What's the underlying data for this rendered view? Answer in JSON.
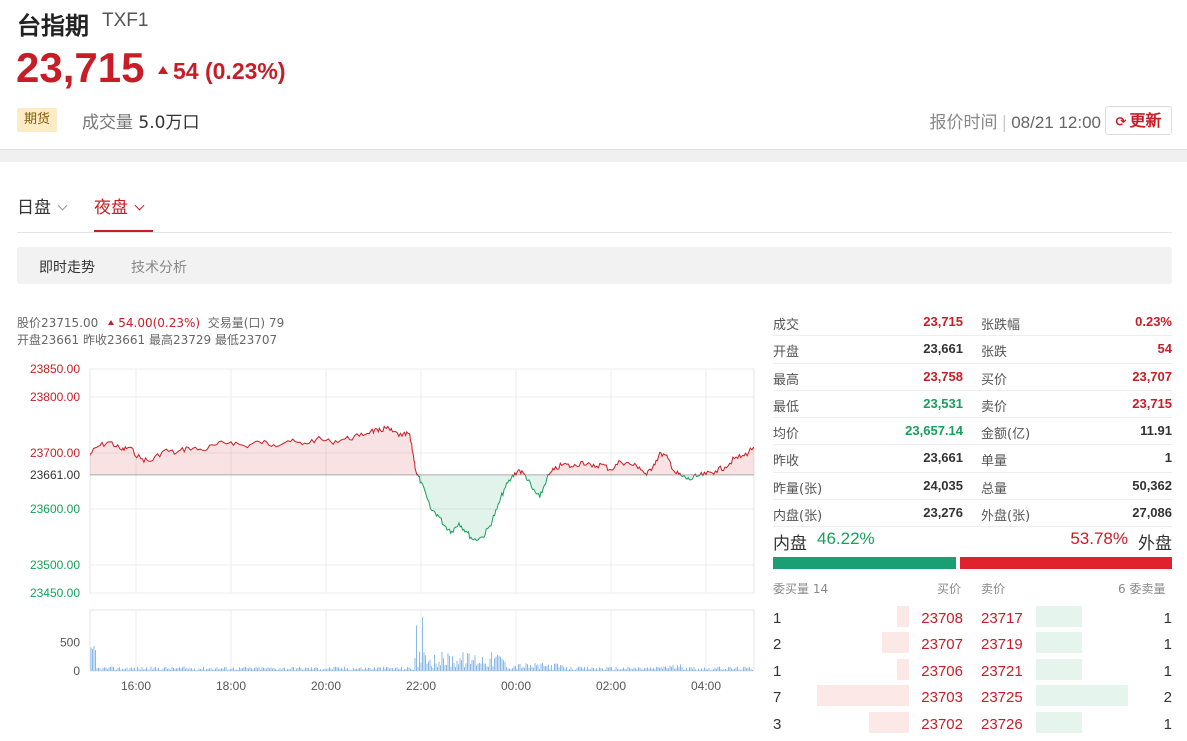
{
  "header": {
    "name": "台指期",
    "code": "TXF1",
    "price": "23,715",
    "change": "54 (0.23%)",
    "badge": "期货",
    "volume_label": "成交量",
    "volume_value": "5.0万口",
    "quote_time_label": "报价时间",
    "quote_time_value": "08/21 12:00",
    "refresh_label": "更新"
  },
  "session_tabs": [
    {
      "label": "日盘",
      "active": false
    },
    {
      "label": "夜盘",
      "active": true
    }
  ],
  "sub_tabs": [
    {
      "label": "即时走势",
      "active": true
    },
    {
      "label": "技术分析",
      "active": false
    }
  ],
  "chart_info": {
    "line1_price": "股价23715.00",
    "line1_change": "54.00(0.23%)",
    "line1_volume": "交易量(口) 79",
    "line2": "开盘23661  昨收23661  最高23729  最低23707"
  },
  "colors": {
    "up": "#c81d26",
    "down": "#16a05a",
    "volume": "#8ab9e8"
  },
  "chart_data": {
    "type": "area",
    "prev_close": 23661,
    "ylim": [
      23450,
      23850
    ],
    "yticks": [
      "23850.00",
      "23800.00",
      "23700.00",
      "23661.00",
      "23600.00",
      "23500.00",
      "23450.00"
    ],
    "ytick_values": [
      23850,
      23800,
      23700,
      23661,
      23600,
      23500,
      23450
    ],
    "xticks": [
      "16:00",
      "18:00",
      "20:00",
      "22:00",
      "00:00",
      "02:00",
      "04:00"
    ],
    "price_series": [
      [
        0,
        23695
      ],
      [
        0.2,
        23712
      ],
      [
        0.45,
        23720
      ],
      [
        0.7,
        23705
      ],
      [
        0.85,
        23710
      ],
      [
        1.1,
        23690
      ],
      [
        1.3,
        23685
      ],
      [
        1.6,
        23705
      ],
      [
        1.85,
        23700
      ],
      [
        2.1,
        23710
      ],
      [
        2.4,
        23705
      ],
      [
        2.7,
        23715
      ],
      [
        3.0,
        23720
      ],
      [
        3.3,
        23712
      ],
      [
        3.6,
        23720
      ],
      [
        3.9,
        23715
      ],
      [
        4.2,
        23722
      ],
      [
        4.5,
        23715
      ],
      [
        4.8,
        23725
      ],
      [
        5.1,
        23720
      ],
      [
        5.4,
        23725
      ],
      [
        5.7,
        23730
      ],
      [
        5.95,
        23740
      ],
      [
        6.1,
        23738
      ],
      [
        6.25,
        23745
      ],
      [
        6.4,
        23738
      ],
      [
        6.6,
        23730
      ],
      [
        6.75,
        23735
      ],
      [
        6.83,
        23700
      ],
      [
        6.9,
        23665
      ],
      [
        7.0,
        23648
      ],
      [
        7.2,
        23600
      ],
      [
        7.35,
        23590
      ],
      [
        7.5,
        23570
      ],
      [
        7.65,
        23560
      ],
      [
        7.8,
        23575
      ],
      [
        7.95,
        23560
      ],
      [
        8.1,
        23545
      ],
      [
        8.3,
        23550
      ],
      [
        8.45,
        23570
      ],
      [
        8.6,
        23600
      ],
      [
        8.75,
        23635
      ],
      [
        8.9,
        23655
      ],
      [
        9.05,
        23670
      ],
      [
        9.2,
        23660
      ],
      [
        9.35,
        23635
      ],
      [
        9.5,
        23620
      ],
      [
        9.65,
        23655
      ],
      [
        9.8,
        23670
      ],
      [
        10.0,
        23680
      ],
      [
        10.2,
        23675
      ],
      [
        10.4,
        23685
      ],
      [
        10.6,
        23675
      ],
      [
        10.8,
        23680
      ],
      [
        11.0,
        23670
      ],
      [
        11.2,
        23685
      ],
      [
        11.4,
        23680
      ],
      [
        11.6,
        23675
      ],
      [
        11.75,
        23660
      ],
      [
        11.9,
        23680
      ],
      [
        12.05,
        23700
      ],
      [
        12.2,
        23690
      ],
      [
        12.35,
        23665
      ],
      [
        12.5,
        23658
      ],
      [
        12.65,
        23652
      ],
      [
        12.8,
        23658
      ],
      [
        13.0,
        23662
      ],
      [
        13.2,
        23668
      ],
      [
        13.4,
        23675
      ],
      [
        13.6,
        23690
      ],
      [
        13.8,
        23695
      ],
      [
        14.0,
        23710
      ],
      [
        14.2,
        23702
      ],
      [
        14.4,
        23720
      ],
      [
        14.6,
        23715
      ],
      [
        14.8,
        23718
      ],
      [
        15.0,
        23714
      ],
      [
        15.2,
        23716
      ],
      [
        15.4,
        23718
      ],
      [
        15.55,
        23715
      ]
    ],
    "volume_ylim": [
      0,
      1000
    ],
    "volume_yticks": [
      "500",
      "0"
    ],
    "volume_ytick_values": [
      500,
      0
    ]
  },
  "stats": [
    {
      "l1": "成交",
      "v1": "23,715",
      "c1": "red",
      "l2": "张跌幅",
      "v2": "0.23%",
      "c2": "red"
    },
    {
      "l1": "开盘",
      "v1": "23,661",
      "c1": "dark",
      "l2": "张跌",
      "v2": "54",
      "c2": "red"
    },
    {
      "l1": "最高",
      "v1": "23,758",
      "c1": "red",
      "l2": "买价",
      "v2": "23,707",
      "c2": "red"
    },
    {
      "l1": "最低",
      "v1": "23,531",
      "c1": "green",
      "l2": "卖价",
      "v2": "23,715",
      "c2": "red"
    },
    {
      "l1": "均价",
      "v1": "23,657.14",
      "c1": "green",
      "l2": "金额(亿)",
      "v2": "11.91",
      "c2": "dark"
    },
    {
      "l1": "昨收",
      "v1": "23,661",
      "c1": "dark",
      "l2": "单量",
      "v2": "1",
      "c2": "dark"
    },
    {
      "l1": "昨量(张)",
      "v1": "24,035",
      "c1": "dark",
      "l2": "总量",
      "v2": "50,362",
      "c2": "dark"
    },
    {
      "l1": "内盘(张)",
      "v1": "23,276",
      "c1": "dark",
      "l2": "外盘(张)",
      "v2": "27,086",
      "c2": "dark"
    }
  ],
  "inout": {
    "in_label": "内盘",
    "in_pct": "46.22%",
    "out_pct": "53.78%",
    "out_label": "外盘",
    "in_fraction": 0.4622
  },
  "orderbook": {
    "bid_qty_label": "委买量 14",
    "bid_price_label": "买价",
    "ask_price_label": "卖价",
    "ask_qty_label": "6 委卖量",
    "rows": [
      {
        "bq": "1",
        "bp": "23708",
        "ap": "23717",
        "aq": "1",
        "bfill": 0.13,
        "afill": 0.5
      },
      {
        "bq": "2",
        "bp": "23707",
        "ap": "23719",
        "aq": "1",
        "bfill": 0.29,
        "afill": 0.5
      },
      {
        "bq": "1",
        "bp": "23706",
        "ap": "23721",
        "aq": "1",
        "bfill": 0.13,
        "afill": 0.5
      },
      {
        "bq": "7",
        "bp": "23703",
        "ap": "23725",
        "aq": "2",
        "bfill": 1.0,
        "afill": 1.0
      },
      {
        "bq": "3",
        "bp": "23702",
        "ap": "23726",
        "aq": "1",
        "bfill": 0.43,
        "afill": 0.5
      }
    ]
  }
}
